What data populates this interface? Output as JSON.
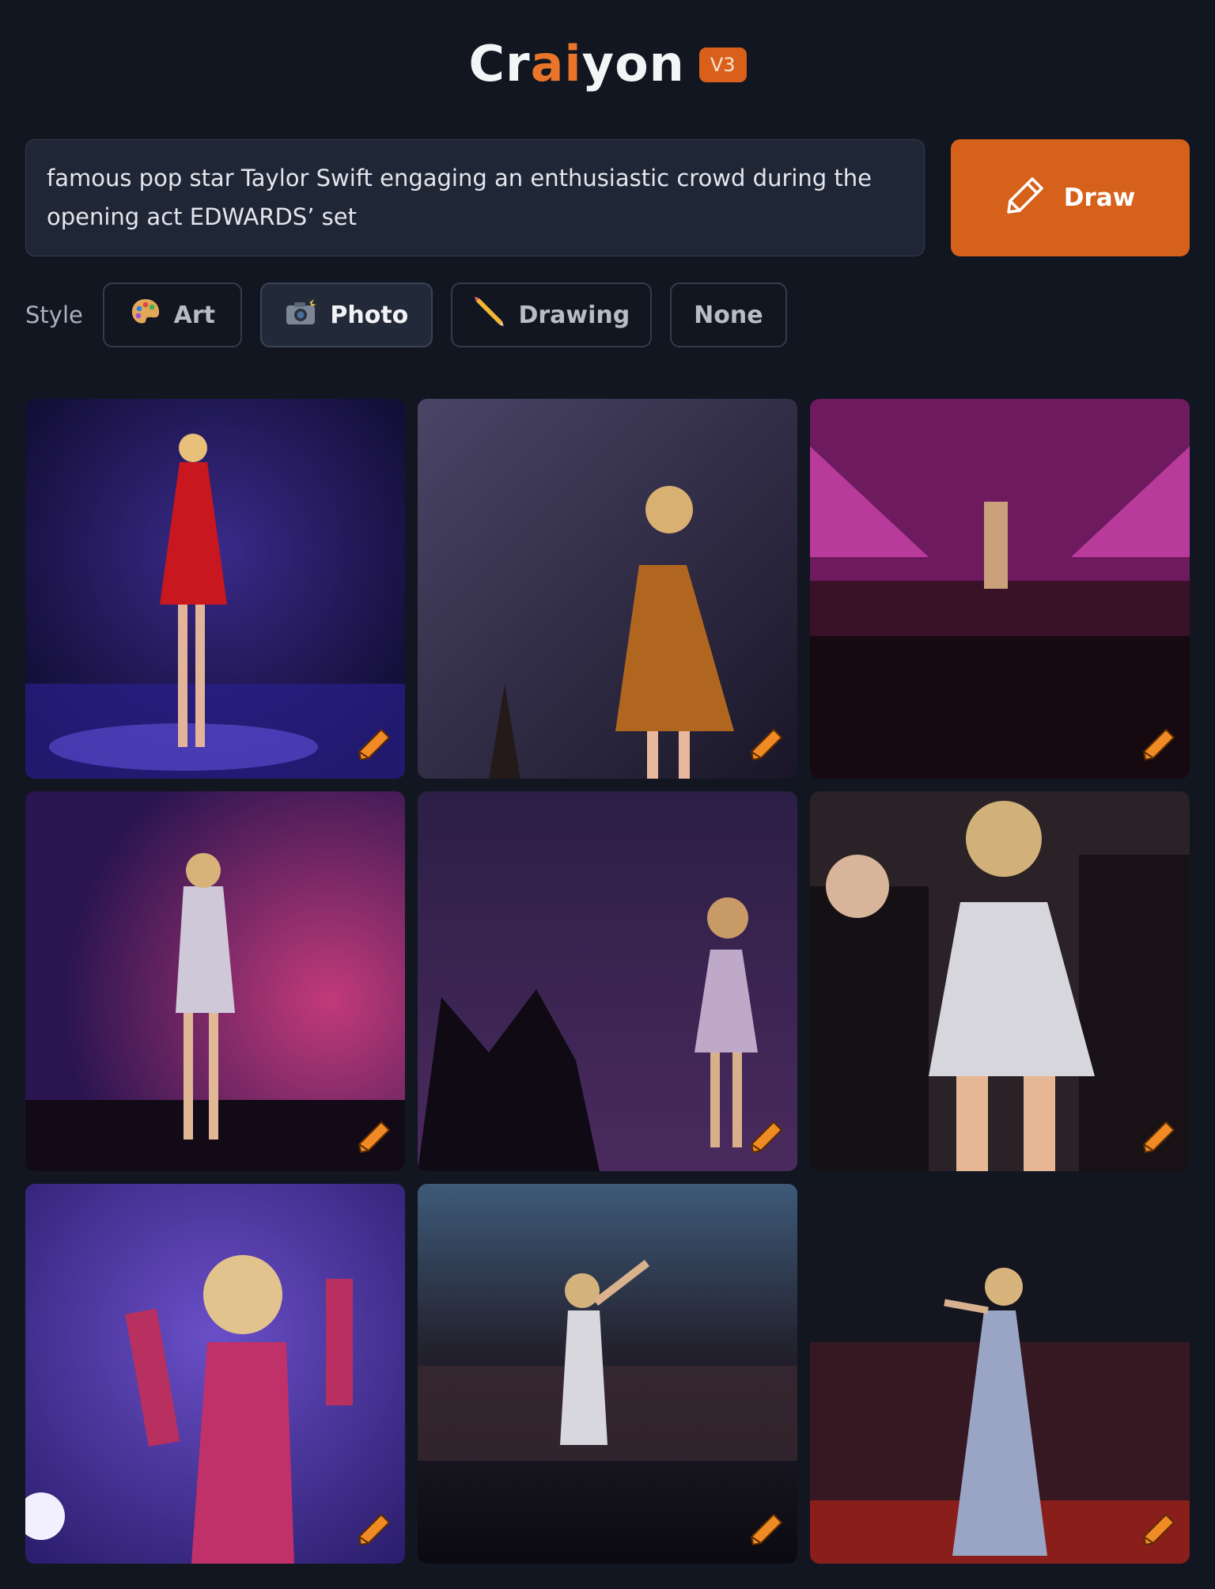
{
  "header": {
    "logo_parts": [
      "Cr",
      "ai",
      "yon"
    ],
    "version": "V3"
  },
  "prompt": {
    "text": "famous pop star Taylor Swift engaging an enthusiastic crowd during the opening act EDWARDS’ set"
  },
  "draw_button": {
    "label": "Draw",
    "icon": "pencil-icon"
  },
  "style": {
    "label": "Style",
    "options": [
      {
        "label": "Art",
        "icon": "palette-icon",
        "selected": false
      },
      {
        "label": "Photo",
        "icon": "camera-flash-icon",
        "selected": true
      },
      {
        "label": "Drawing",
        "icon": "pencil-emoji-icon",
        "selected": false
      },
      {
        "label": "None",
        "icon": "",
        "selected": false
      }
    ]
  },
  "results": {
    "images": [
      {
        "description": "performer in red dress on blue stage"
      },
      {
        "description": "performer in gold sequin dress singing"
      },
      {
        "description": "performer on pink-lit stage above crowd"
      },
      {
        "description": "performer in silver outfit at mic stand"
      },
      {
        "description": "performer singing to raised hands"
      },
      {
        "description": "performer in silver fringe outfit with fans"
      },
      {
        "description": "performer in red sequin outfit singing"
      },
      {
        "description": "performer pointing over arena crowd"
      },
      {
        "description": "performer in silver gown above crowd"
      }
    ],
    "edit_icon": "pencil-edit-icon"
  },
  "colors": {
    "background": "#111621",
    "accent": "#d5611b"
  }
}
